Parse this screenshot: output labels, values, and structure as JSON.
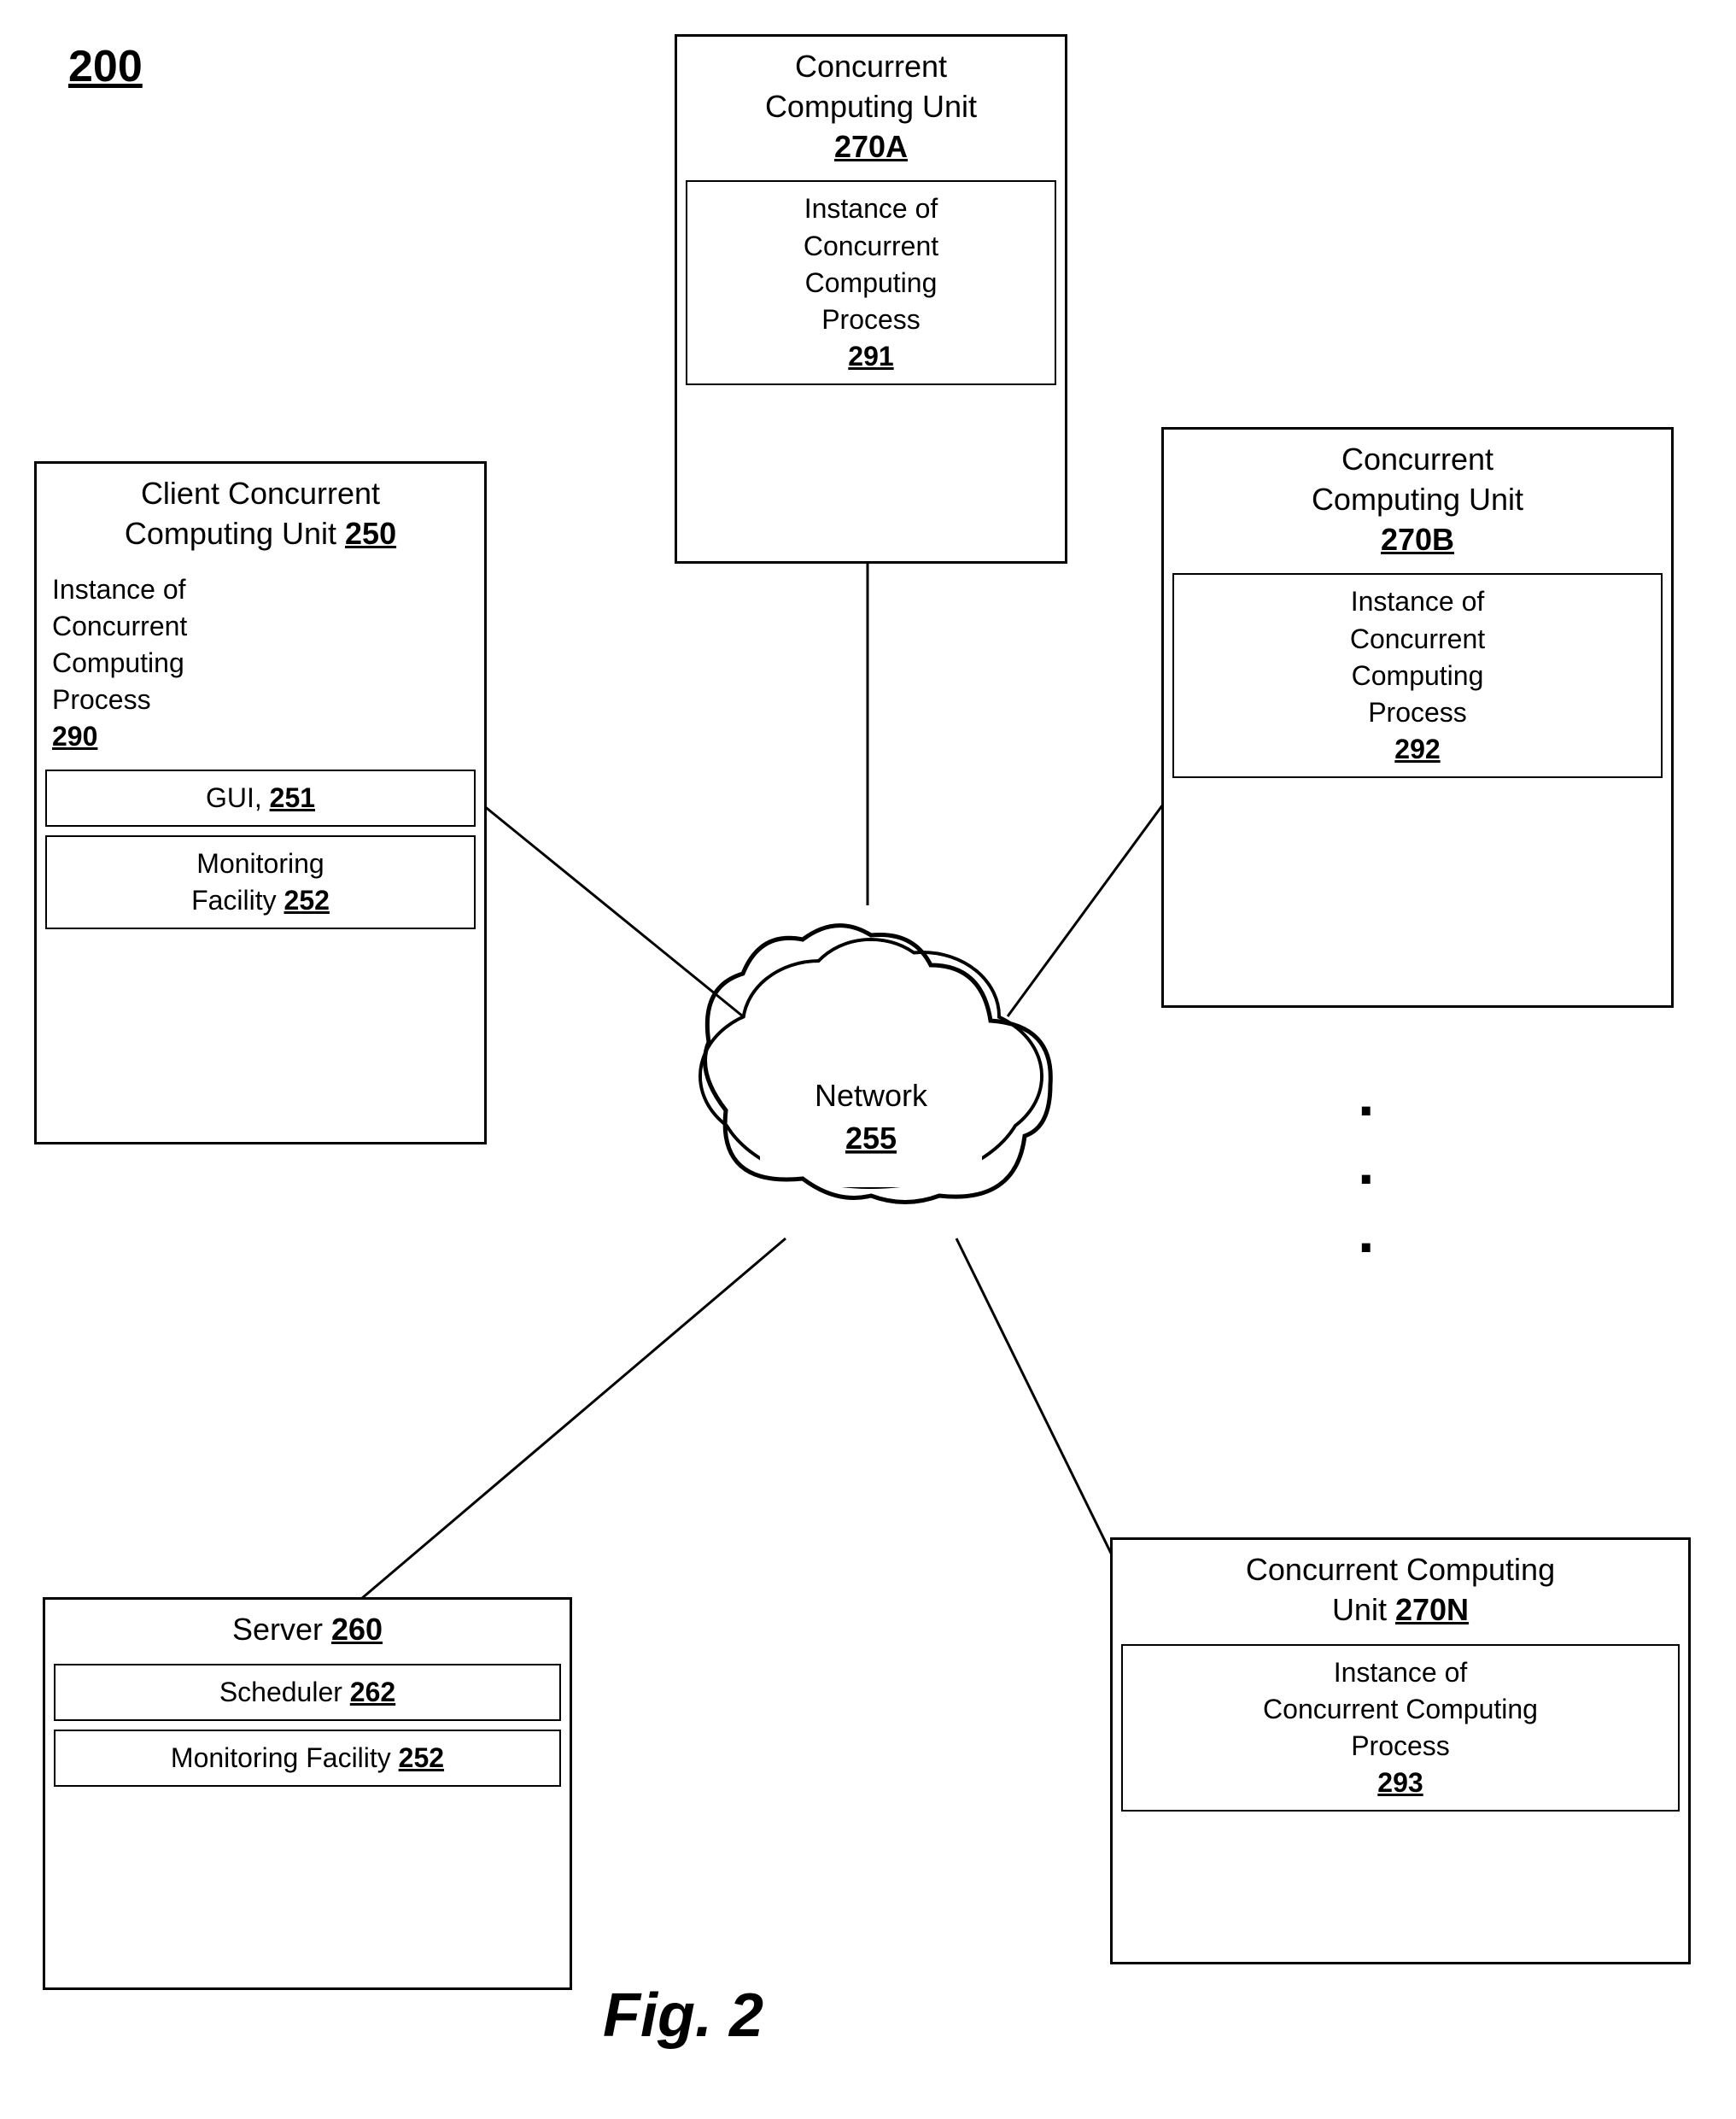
{
  "diagram": {
    "reference": "200",
    "fig_label": "Fig. 2",
    "network": {
      "label": "Network",
      "ref": "255"
    },
    "client_unit": {
      "title_line1": "Client Concurrent",
      "title_line2": "Computing Unit",
      "ref": "250",
      "process": {
        "line1": "Instance of",
        "line2": "Concurrent",
        "line3": "Computing",
        "line4": "Process",
        "ref": "290"
      },
      "gui": {
        "label": "GUI,",
        "ref": "251"
      },
      "monitoring": {
        "label": "Monitoring",
        "label2": "Facility",
        "ref": "252"
      }
    },
    "unit_270A": {
      "title_line1": "Concurrent",
      "title_line2": "Computing Unit",
      "ref": "270A",
      "process": {
        "line1": "Instance of",
        "line2": "Concurrent",
        "line3": "Computing",
        "line4": "Process",
        "ref": "291"
      }
    },
    "unit_270B": {
      "title_line1": "Concurrent",
      "title_line2": "Computing Unit",
      "ref": "270B",
      "process": {
        "line1": "Instance of",
        "line2": "Concurrent",
        "line3": "Computing",
        "line4": "Process",
        "ref": "292"
      }
    },
    "unit_270N": {
      "title_line1": "Concurrent Computing",
      "title_line2": "Unit",
      "ref": "270N",
      "process": {
        "line1": "Instance of",
        "line2": "Concurrent Computing",
        "line3": "Process",
        "ref": "293"
      }
    },
    "server": {
      "title": "Server",
      "ref": "260",
      "scheduler": {
        "label": "Scheduler",
        "ref": "262"
      },
      "monitoring": {
        "label": "Monitoring Facility",
        "ref": "252"
      }
    },
    "monitoring_252": {
      "label": "Monitoring",
      "label2": "Facility",
      "ref": "252"
    }
  }
}
